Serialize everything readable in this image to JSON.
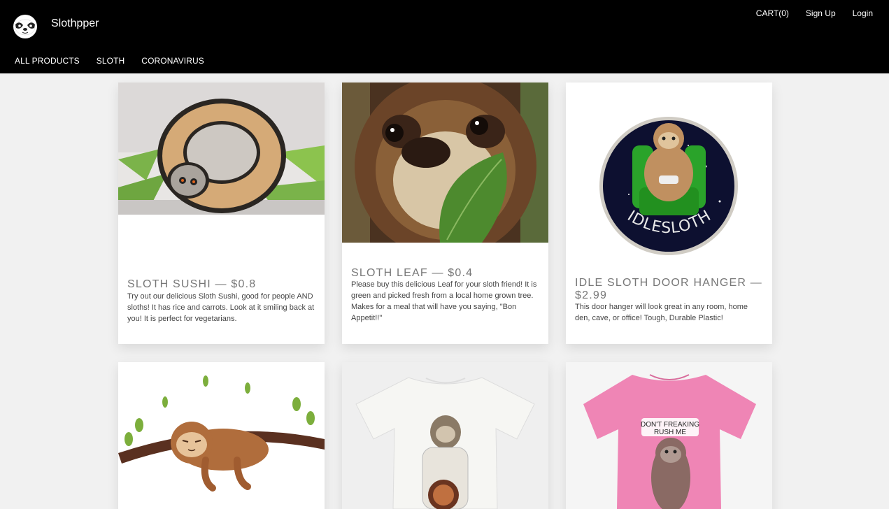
{
  "header": {
    "brand": "Slothpper",
    "logo_icon": "sloth-face-icon",
    "nav": {
      "cart": "CART(0)",
      "signup": "Sign Up",
      "login": "Login"
    },
    "categories": [
      "ALL PRODUCTS",
      "SLOTH",
      "CORONAVIRUS"
    ]
  },
  "products": [
    {
      "title": "SLOTH SUSHI — $0.8",
      "description": "Try out our delicious Sloth Sushi, good for people AND sloths! It has rice and carrots. Look at it smiling back at you! It is perfect for vegetarians.",
      "image": "sloth-sushi-image"
    },
    {
      "title": "SLOTH LEAF — $0.4",
      "description": "Please buy this delicious Leaf for your sloth friend! It is green and picked fresh from a local home grown tree. Makes for a meal that will have you saying, \"Bon Appetit!!\"",
      "image": "sloth-eating-leaf-image"
    },
    {
      "title": "IDLE SLOTH DOOR HANGER — $2.99",
      "description": "This door hanger will look great in any room, home den, cave, or office! Tough, Durable Plastic!",
      "image": "idlesloth-door-hanger-image"
    },
    {
      "image": "sleeping-sloth-on-branch-image"
    },
    {
      "image": "astronaut-sloth-tshirt-image"
    },
    {
      "image": "pink-sloth-tshirt-image",
      "shirt_text_line1": "DON'T FREAKING",
      "shirt_text_line2": "RUSH ME"
    }
  ],
  "door_hanger_text": "IDLESLOTH",
  "colors": {
    "header_bg": "#000000",
    "page_bg": "#f1f1f1",
    "card_bg": "#ffffff"
  }
}
